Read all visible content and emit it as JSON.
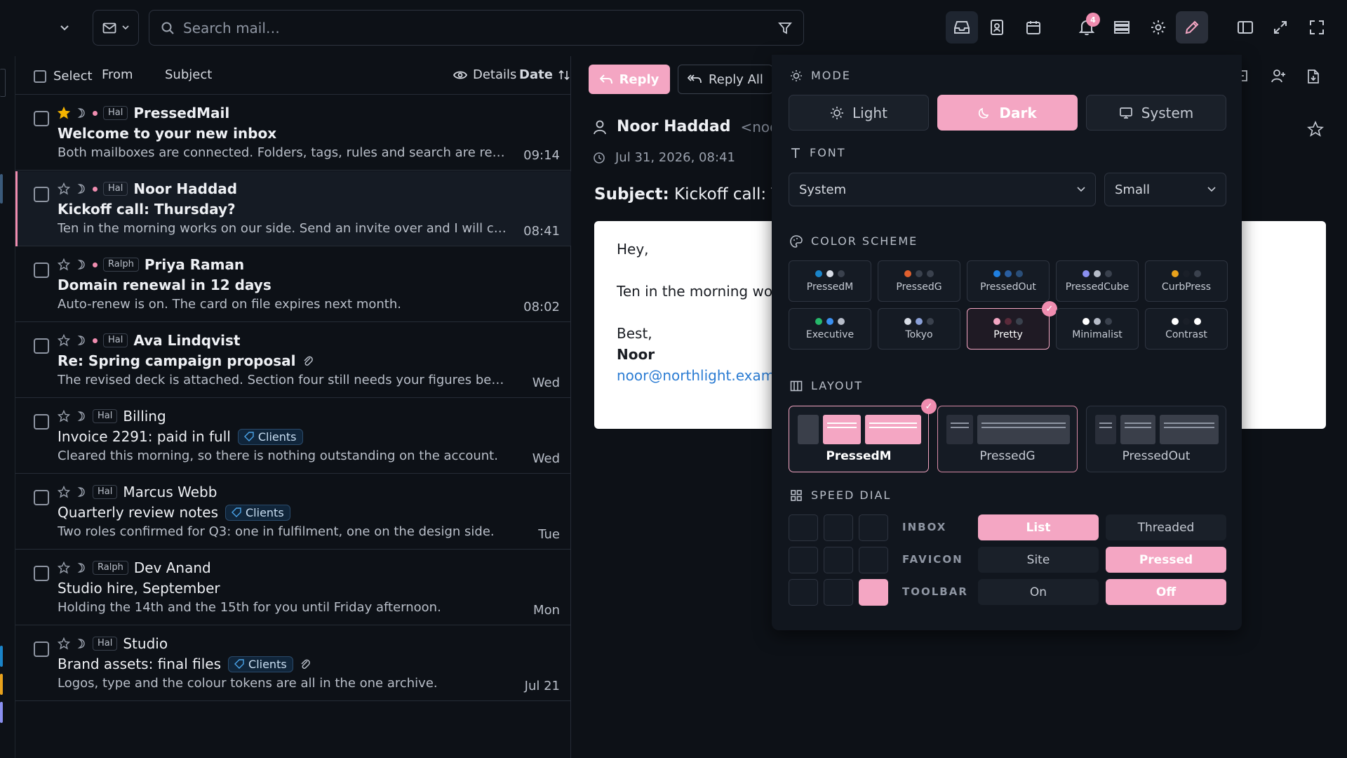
{
  "topbar": {
    "search_placeholder": "Search mail…",
    "notif_count": "4",
    "icons": [
      "inbox-icon",
      "address-book-icon",
      "calendar-icon",
      "bell-icon",
      "list-icon",
      "gear-icon",
      "pencil-icon",
      "sidebar-toggle-icon",
      "expand-icon",
      "fullscreen-icon"
    ]
  },
  "list": {
    "header": {
      "select": "Select",
      "from": "From",
      "subject": "Subject",
      "details": "Details",
      "date": "Date"
    },
    "rows": [
      {
        "starred": true,
        "unread": true,
        "account": "Hal",
        "sender": "PressedMail",
        "subject": "Welcome to your new inbox",
        "preview": "Both mailboxes are connected. Folders, tags, rules and search are rea...",
        "time": "09:14",
        "tag": "",
        "attachment": false,
        "bold": true
      },
      {
        "starred": false,
        "unread": true,
        "account": "Hal",
        "sender": "Noor Haddad",
        "subject": "Kickoff call: Thursday?",
        "preview": "Ten in the morning works on our side. Send an invite over and I will co...",
        "time": "08:41",
        "tag": "",
        "attachment": false,
        "bold": true
      },
      {
        "starred": false,
        "unread": true,
        "account": "Ralph",
        "sender": "Priya Raman",
        "subject": "Domain renewal in 12 days",
        "preview": "Auto-renew is on. The card on file expires next month.",
        "time": "08:02",
        "tag": "",
        "attachment": false,
        "bold": true
      },
      {
        "starred": false,
        "unread": true,
        "account": "Hal",
        "sender": "Ava Lindqvist",
        "subject": "Re: Spring campaign proposal",
        "preview": "The revised deck is attached. Section four still needs your figures befo...",
        "time": "Wed",
        "tag": "",
        "attachment": true,
        "bold": true
      },
      {
        "starred": false,
        "unread": false,
        "account": "Hal",
        "sender": "Billing",
        "subject": "Invoice 2291: paid in full",
        "preview": "Cleared this morning, so there is nothing outstanding on the account.",
        "time": "Wed",
        "tag": "Clients",
        "attachment": false,
        "bold": false
      },
      {
        "starred": false,
        "unread": false,
        "account": "Hal",
        "sender": "Marcus Webb",
        "subject": "Quarterly review notes",
        "preview": "Two roles confirmed for Q3: one in fulfilment, one on the design side.",
        "time": "Tue",
        "tag": "Clients",
        "attachment": false,
        "bold": false
      },
      {
        "starred": false,
        "unread": false,
        "account": "Ralph",
        "sender": "Dev Anand",
        "subject": "Studio hire, September",
        "preview": "Holding the 14th and the 15th for you until Friday afternoon.",
        "time": "Mon",
        "tag": "",
        "attachment": false,
        "bold": false
      },
      {
        "starred": false,
        "unread": false,
        "account": "Hal",
        "sender": "Studio",
        "subject": "Brand assets: final files",
        "preview": "Logos, type and the colour tokens are all in the one archive.",
        "time": "Jul 21",
        "tag": "Clients",
        "attachment": true,
        "bold": false
      }
    ]
  },
  "reader": {
    "reply": "Reply",
    "reply_all": "Reply All",
    "from_name": "Noor Haddad",
    "from_email": "<noor",
    "date": "Jul 31, 2026, 08:41",
    "subject_label": "Subject:",
    "subject": "Kickoff call: Thu",
    "body_greeting": "Hey,",
    "body_line": "Ten in the morning wor",
    "body_signoff": "Best,",
    "body_name": "Noor",
    "body_email": "noor@northlight.exam"
  },
  "panel": {
    "mode": {
      "title": "MODE",
      "light": "Light",
      "dark": "Dark",
      "system": "System",
      "selected": "Dark"
    },
    "font": {
      "title": "FONT",
      "family": "System",
      "size": "Small"
    },
    "scheme": {
      "title": "COLOR SCHEME",
      "selected": "Pretty",
      "items": [
        {
          "name": "PressedM",
          "dots": [
            "#1a84c9",
            "#d8dde6",
            "#3a414d"
          ]
        },
        {
          "name": "PressedG",
          "dots": [
            "#e0602e",
            "#3a414d",
            "#3a414d"
          ]
        },
        {
          "name": "PressedOut",
          "dots": [
            "#1f7fe0",
            "#2a5ea0",
            "#2a4e78"
          ]
        },
        {
          "name": "PressedCube",
          "dots": [
            "#8a8ff0",
            "#b6bcc8",
            "#3a414d"
          ]
        },
        {
          "name": "CurbPress",
          "dots": [
            "#e8a21c",
            "#1a1f28",
            "#3a414d"
          ]
        },
        {
          "name": "Executive",
          "dots": [
            "#26b86a",
            "#3a8ff0",
            "#b6bcc8"
          ]
        },
        {
          "name": "Tokyo",
          "dots": [
            "#d8dde6",
            "#8aa0d8",
            "#3a414d"
          ]
        },
        {
          "name": "Pretty",
          "dots": [
            "#f4a6c3",
            "#5a2a3a",
            "#3a414d"
          ]
        },
        {
          "name": "Minimalist",
          "dots": [
            "#ffffff",
            "#b6bcc8",
            "#3a414d"
          ]
        },
        {
          "name": "Contrast",
          "dots": [
            "#ffffff",
            "#1a1f28",
            "#ffffff"
          ]
        }
      ]
    },
    "layout": {
      "title": "LAYOUT",
      "items": [
        "PressedM",
        "PressedG",
        "PressedOut"
      ],
      "selected": "PressedM"
    },
    "speed_dial": {
      "title": "SPEED DIAL",
      "inbox": {
        "label": "INBOX",
        "a": "List",
        "b": "Threaded",
        "selected": "List"
      },
      "favicon": {
        "label": "FAVICON",
        "a": "Site",
        "b": "Pressed",
        "selected": "Pressed"
      },
      "toolbar": {
        "label": "TOOLBAR",
        "a": "On",
        "b": "Off",
        "selected": "Off"
      }
    }
  },
  "colors": {
    "accent": "#f4a6c3",
    "background": "#0d1117",
    "panel": "#11161e"
  }
}
